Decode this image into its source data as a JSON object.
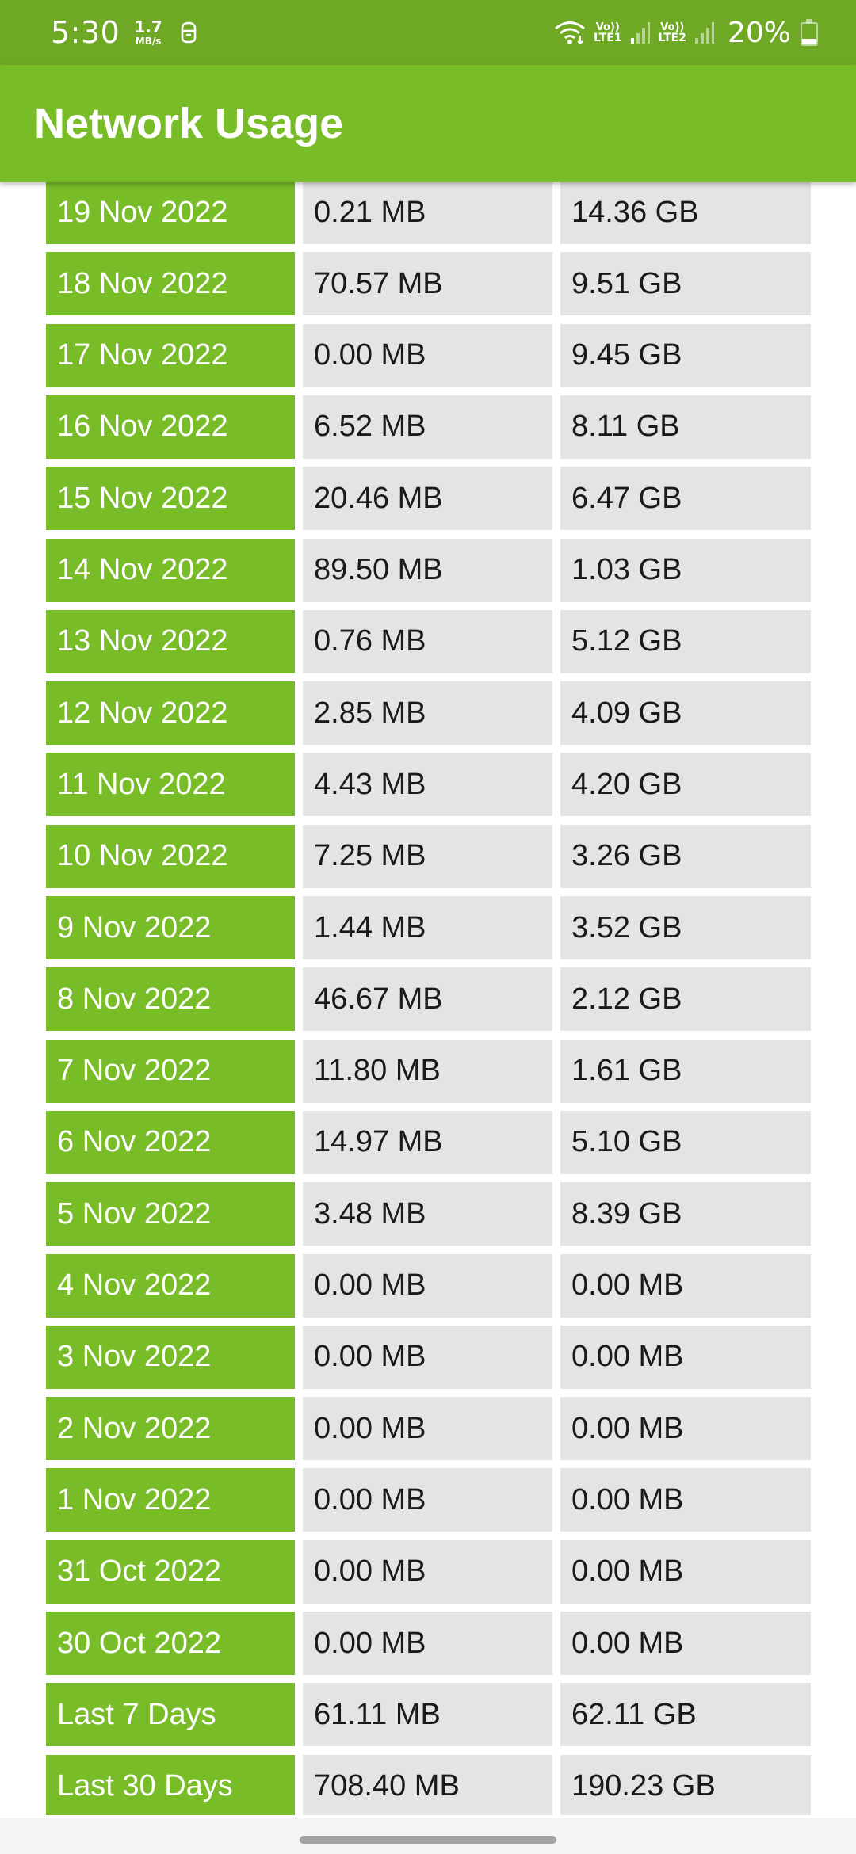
{
  "status_bar": {
    "time": "5:30",
    "speed_value": "1.7",
    "speed_unit": "MB/s",
    "sim1_top": "Vo))",
    "sim1_bottom": "LTE1",
    "sim2_top": "Vo))",
    "sim2_bottom": "LTE2",
    "battery_percent": "20%",
    "battery_level": 0.2,
    "icons": [
      "notification-icon",
      "wifi-icon",
      "signal-icon",
      "battery-icon"
    ]
  },
  "app_bar": {
    "title": "Network Usage"
  },
  "colors": {
    "status_bar": "#6ea824",
    "primary": "#78bc27",
    "cell_bg": "#e4e4e4",
    "text_dark": "#1a1a1a",
    "text_light": "#ffffff"
  },
  "rows": [
    {
      "date": "19 Nov 2022",
      "col1": "0.21 MB",
      "col2": "14.36 GB"
    },
    {
      "date": "18 Nov 2022",
      "col1": "70.57 MB",
      "col2": "9.51 GB"
    },
    {
      "date": "17 Nov 2022",
      "col1": "0.00 MB",
      "col2": "9.45 GB"
    },
    {
      "date": "16 Nov 2022",
      "col1": "6.52 MB",
      "col2": "8.11 GB"
    },
    {
      "date": "15 Nov 2022",
      "col1": "20.46 MB",
      "col2": "6.47 GB"
    },
    {
      "date": "14 Nov 2022",
      "col1": "89.50 MB",
      "col2": "1.03 GB"
    },
    {
      "date": "13 Nov 2022",
      "col1": "0.76 MB",
      "col2": "5.12 GB"
    },
    {
      "date": "12 Nov 2022",
      "col1": "2.85 MB",
      "col2": "4.09 GB"
    },
    {
      "date": "11 Nov 2022",
      "col1": "4.43 MB",
      "col2": "4.20 GB"
    },
    {
      "date": "10 Nov 2022",
      "col1": "7.25 MB",
      "col2": "3.26 GB"
    },
    {
      "date": "9 Nov 2022",
      "col1": "1.44 MB",
      "col2": "3.52 GB"
    },
    {
      "date": "8 Nov 2022",
      "col1": "46.67 MB",
      "col2": "2.12 GB"
    },
    {
      "date": "7 Nov 2022",
      "col1": "11.80 MB",
      "col2": "1.61 GB"
    },
    {
      "date": "6 Nov 2022",
      "col1": "14.97 MB",
      "col2": "5.10 GB"
    },
    {
      "date": "5 Nov 2022",
      "col1": "3.48 MB",
      "col2": "8.39 GB"
    },
    {
      "date": "4 Nov 2022",
      "col1": "0.00 MB",
      "col2": "0.00 MB"
    },
    {
      "date": "3 Nov 2022",
      "col1": "0.00 MB",
      "col2": "0.00 MB"
    },
    {
      "date": "2 Nov 2022",
      "col1": "0.00 MB",
      "col2": "0.00 MB"
    },
    {
      "date": "1 Nov 2022",
      "col1": "0.00 MB",
      "col2": "0.00 MB"
    },
    {
      "date": "31 Oct 2022",
      "col1": "0.00 MB",
      "col2": "0.00 MB"
    },
    {
      "date": "30 Oct 2022",
      "col1": "0.00 MB",
      "col2": "0.00 MB"
    },
    {
      "date": "Last 7 Days",
      "col1": "61.11 MB",
      "col2": "62.11 GB"
    },
    {
      "date": "Last 30 Days",
      "col1": "708.40 MB",
      "col2": "190.23 GB"
    }
  ]
}
